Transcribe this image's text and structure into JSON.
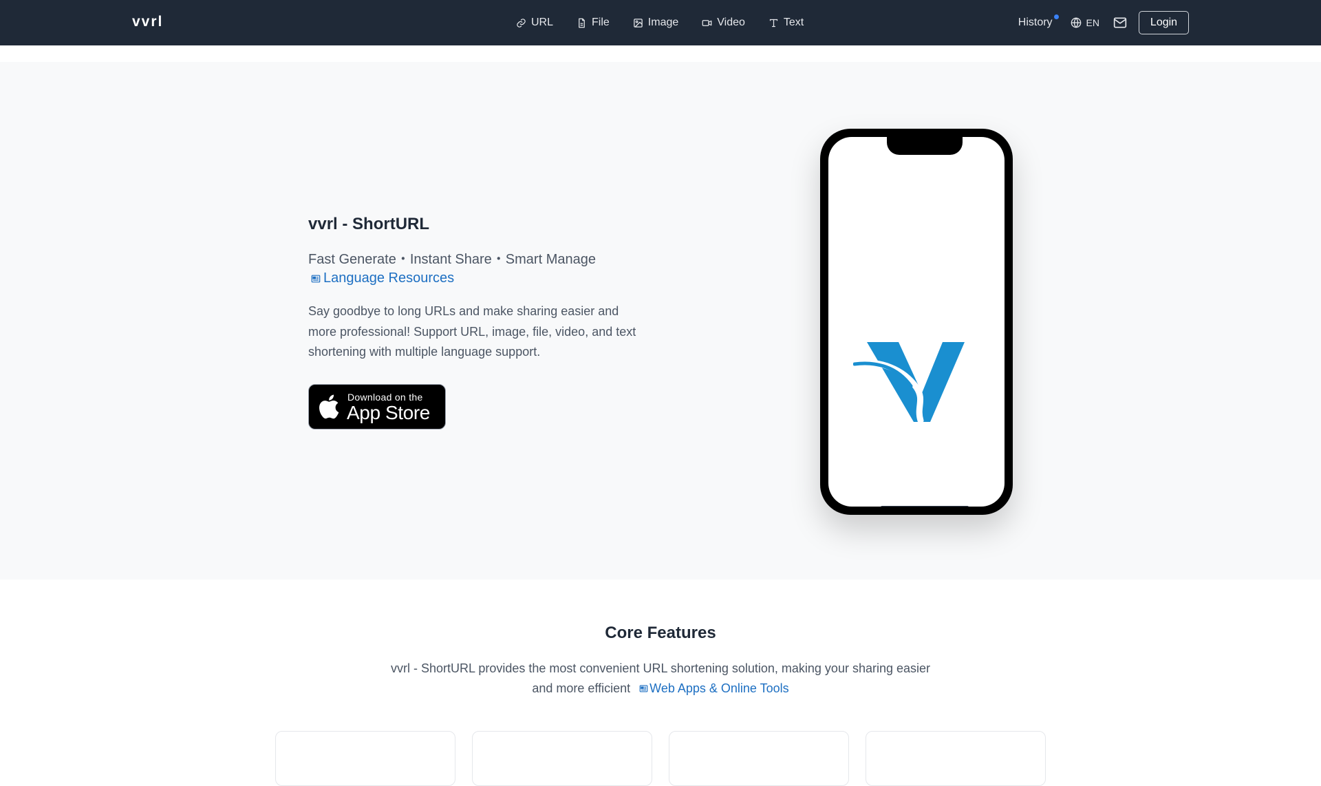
{
  "navbar": {
    "brand": "vvrl",
    "links": [
      {
        "label": "URL",
        "icon": "link-icon"
      },
      {
        "label": "File",
        "icon": "file-icon"
      },
      {
        "label": "Image",
        "icon": "image-icon"
      },
      {
        "label": "Video",
        "icon": "video-icon"
      },
      {
        "label": "Text",
        "icon": "text-icon"
      }
    ],
    "history_label": "History",
    "language_label": "EN",
    "login_label": "Login",
    "notification_dot_color": "#3b82f6"
  },
  "hero": {
    "title": "vvrl - ShortURL",
    "tagline": "Fast Generate・Instant Share・Smart Manage",
    "resource_link": "Language Resources",
    "description": "Say goodbye to long URLs and make sharing easier and more professional! Support URL, image, file, video, and text shortening with multiple language support.",
    "appstore": {
      "line1": "Download on the",
      "line2": "App Store"
    },
    "logo_color": "#1a8fd0"
  },
  "features": {
    "title": "Core Features",
    "description": "vvrl - ShortURL provides the most convenient URL shortening solution, making your sharing easier and more efficient",
    "link": "Web Apps & Online Tools"
  },
  "colors": {
    "navbar_bg": "#1f2937",
    "hero_bg": "#f8f9fa",
    "link": "#1d6fc2"
  }
}
